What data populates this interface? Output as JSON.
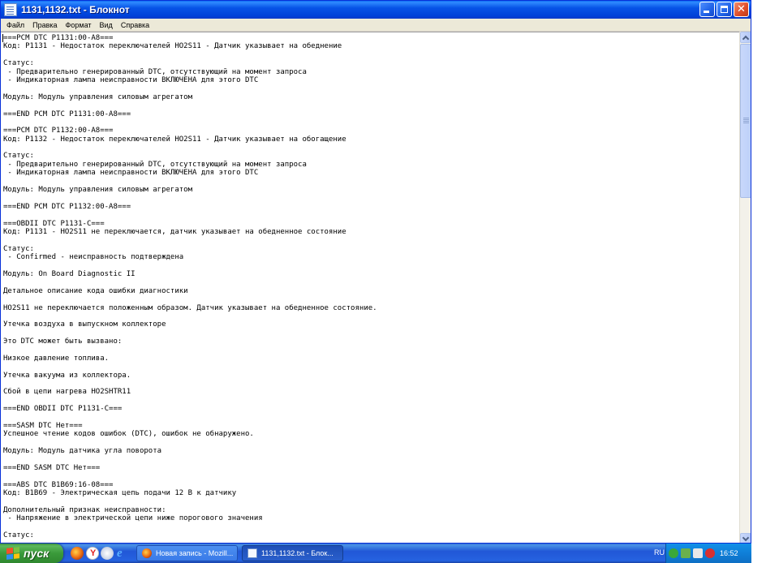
{
  "window": {
    "title": "1131,1132.txt - Блокнот"
  },
  "menu": [
    "Файл",
    "Правка",
    "Формат",
    "Вид",
    "Справка"
  ],
  "document_lines": [
    "===PCM DTC P1131:00-A8===",
    "Код: P1131 - Недостаток переключателей HO2S11 - Датчик указывает на обеднение",
    "",
    "Статус:",
    " - Предварительно генерированный DTC, отсутствующий на момент запроса",
    " - Индикаторная лампа неисправности ВКЛЮЧЕНА для этого DTC",
    "",
    "Модуль: Модуль управления силовым агрегатом",
    "",
    "===END PCM DTC P1131:00-A8===",
    "",
    "===PCM DTC P1132:00-A8===",
    "Код: P1132 - Недостаток переключателей HO2S11 - Датчик указывает на обогащение",
    "",
    "Статус:",
    " - Предварительно генерированный DTC, отсутствующий на момент запроса",
    " - Индикаторная лампа неисправности ВКЛЮЧЕНА для этого DTC",
    "",
    "Модуль: Модуль управления силовым агрегатом",
    "",
    "===END PCM DTC P1132:00-A8===",
    "",
    "===OBDII DTC P1131-C===",
    "Код: P1131 - HO2S11 не переключается, датчик указывает на обедненное состояние",
    "",
    "Статус:",
    " - Confirmed - неисправность подтверждена",
    "",
    "Модуль: On Board Diagnostic II",
    "",
    "Детальное описание кода ошибки диагностики",
    "",
    "HO2S11 не переключается положенным образом. Датчик указывает на обедненное состояние.",
    "",
    "Утечка воздуха в выпускном коллекторе",
    "",
    "Это DTC может быть вызвано:",
    "",
    "Низкое давление топлива.",
    "",
    "Утечка вакуума из коллектора.",
    "",
    "Сбой в цепи нагрева HO2SHTR11",
    "",
    "===END OBDII DTC P1131-C===",
    "",
    "===SASM DTC Нет===",
    "Успешное чтение кодов ошибок (DTC), ошибок не обнаружено.",
    "",
    "Модуль: Модуль датчика угла поворота",
    "",
    "===END SASM DTC Нет===",
    "",
    "===ABS DTC B1B69:16-08===",
    "Код: B1B69 - Электрическая цепь подачи 12 В к датчику",
    "",
    "Дополнительный признак неисправности:",
    " - Напряжение в электрической цепи ниже порогового значения",
    "",
    "Статус:"
  ],
  "taskbar": {
    "start_label": "пуск",
    "tasks": [
      {
        "label": "Новая запись - Mozill...",
        "icon": "firefox-icon",
        "active": false
      },
      {
        "label": "1131,1132.txt - Блок...",
        "icon": "notepad-icon",
        "active": true
      }
    ],
    "language": "RU",
    "clock": "16:52"
  },
  "colors": {
    "titlebar": "#0753e6",
    "taskbar": "#2157d7",
    "start_button": "#3a9a3a",
    "tray": "#0f7fd8"
  }
}
